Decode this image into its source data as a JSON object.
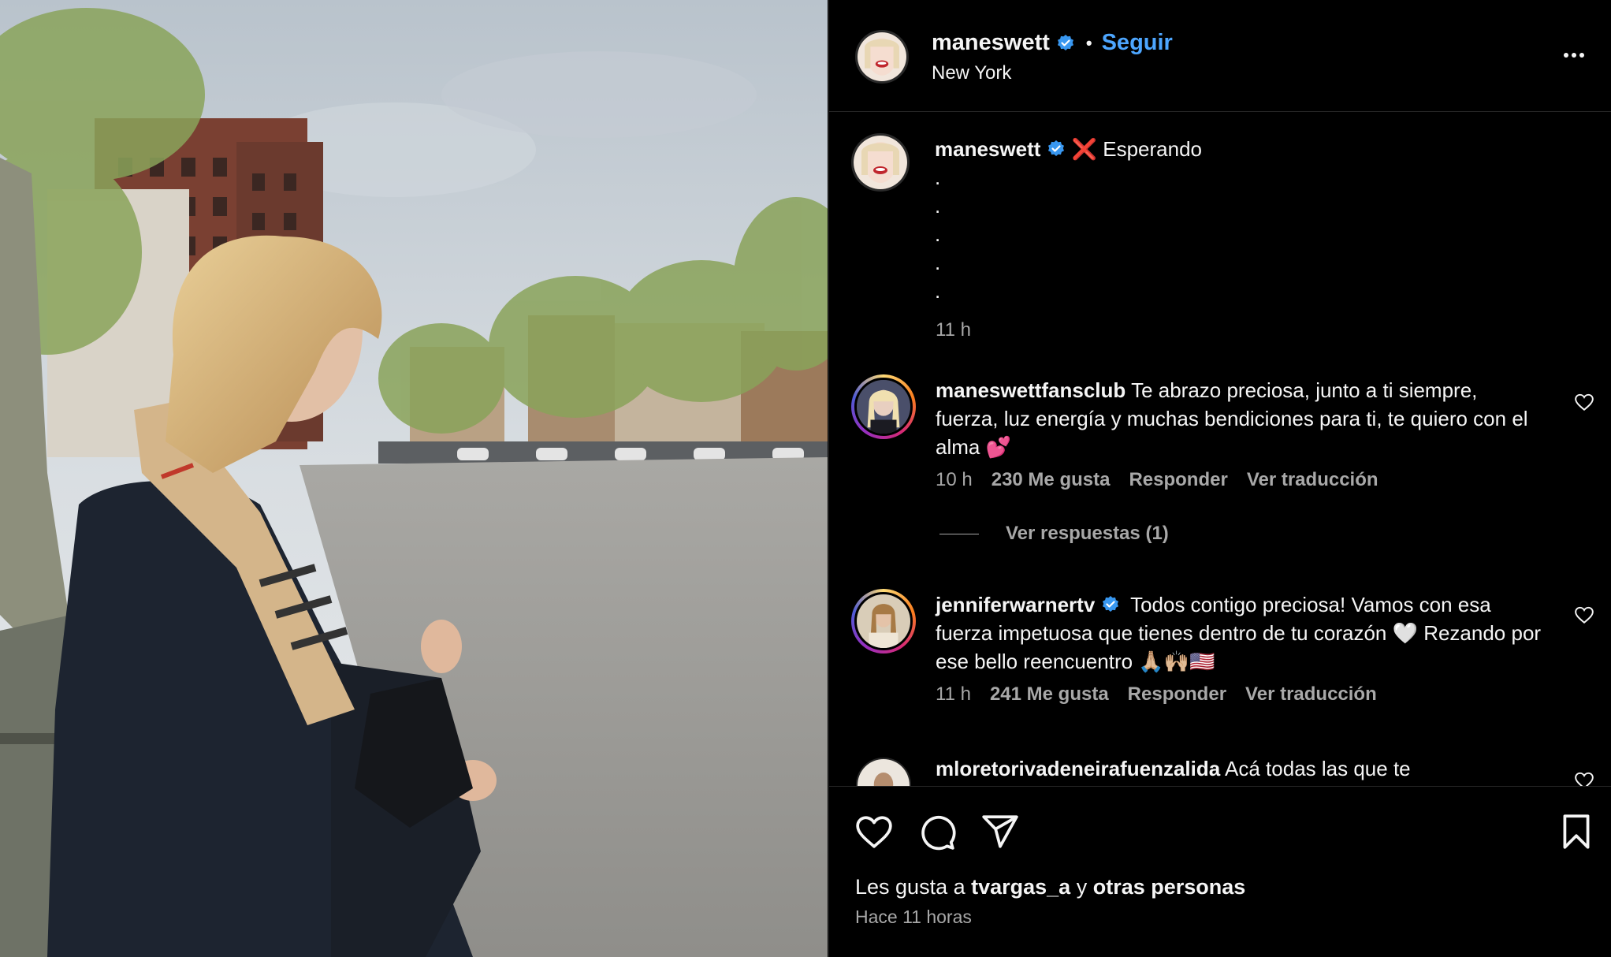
{
  "header": {
    "username": "maneswett",
    "separator": "•",
    "follow_label": "Seguir",
    "location": "New York",
    "verified_icon": "verified-badge-icon",
    "more_icon": "more-options-icon"
  },
  "caption": {
    "username": "maneswett",
    "emoji": "❌",
    "text": "Esperando",
    "dots": [
      ".",
      ".",
      ".",
      ".",
      "."
    ],
    "time": "11 h"
  },
  "comments": [
    {
      "username": "maneswettfansclub",
      "text": "Te abrazo preciosa, junto a ti siempre, fuerza, luz energía y muchas bendiciones para ti, te quiero con el alma 💕",
      "time": "10 h",
      "likes": "230 Me gusta",
      "reply": "Responder",
      "translate": "Ver traducción",
      "view_replies": "Ver respuestas (1)"
    },
    {
      "username": "jenniferwarnertv",
      "text": "Todos contigo preciosa! Vamos con esa fuerza impetuosa que tienes dentro de tu corazón 🤍 Rezando por ese bello reencuentro 🙏🏼🙌🏼🇺🇸",
      "time": "11 h",
      "likes": "241 Me gusta",
      "reply": "Responder",
      "translate": "Ver traducción"
    },
    {
      "username": "mloretorivadeneirafuenzalida",
      "text": "Acá todas las que te"
    }
  ],
  "footer": {
    "likes_prefix": "Les gusta a ",
    "likes_user": "tvargas_a",
    "likes_mid": " y ",
    "likes_others": "otras personas",
    "posted": "Hace 11 horas"
  },
  "colors": {
    "accent": "#4da6ff",
    "verified": "#3897f0",
    "secondary_text": "#a8a8a8"
  }
}
